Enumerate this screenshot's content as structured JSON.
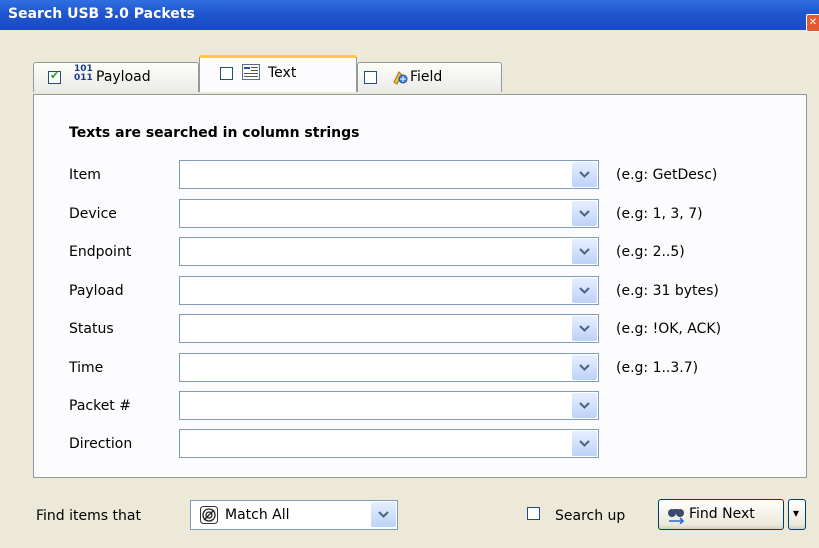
{
  "window": {
    "title": "Search USB 3.0 Packets",
    "close_glyph": "✕"
  },
  "tabs": [
    {
      "label": "Payload",
      "checked": true,
      "icon": "binary-icon",
      "icon_top": "101",
      "icon_bottom": "011"
    },
    {
      "label": "Text",
      "checked": false,
      "icon": "text-field-icon"
    },
    {
      "label": "Field",
      "checked": false,
      "icon": "field-icon"
    }
  ],
  "text_tab": {
    "heading": "Texts are searched in column strings",
    "rows": [
      {
        "label": "Item",
        "value": "",
        "example": "(e.g: GetDesc)"
      },
      {
        "label": "Device",
        "value": "",
        "example": "(e.g: 1, 3, 7)"
      },
      {
        "label": "Endpoint",
        "value": "",
        "example": "(e.g: 2..5)"
      },
      {
        "label": "Payload",
        "value": "",
        "example": "(e.g: 31 bytes)"
      },
      {
        "label": "Status",
        "value": "",
        "example": "(e.g: !OK, ACK)"
      },
      {
        "label": "Time",
        "value": "",
        "example": "(e.g: 1..3.7)"
      },
      {
        "label": "Packet #",
        "value": "",
        "example": ""
      },
      {
        "label": "Direction",
        "value": "",
        "example": ""
      }
    ]
  },
  "footer": {
    "find_items_label": "Find items that",
    "match_value": "Match All",
    "search_up_label": "Search up",
    "search_up_checked": false,
    "find_next_label": "Find Next",
    "split_arrow": "▾"
  },
  "colors": {
    "titlebar": "#1f56cf",
    "tab_highlight": "#ffc83c",
    "checkmark": "#21a121",
    "dropdown": "#bcd2f8"
  }
}
